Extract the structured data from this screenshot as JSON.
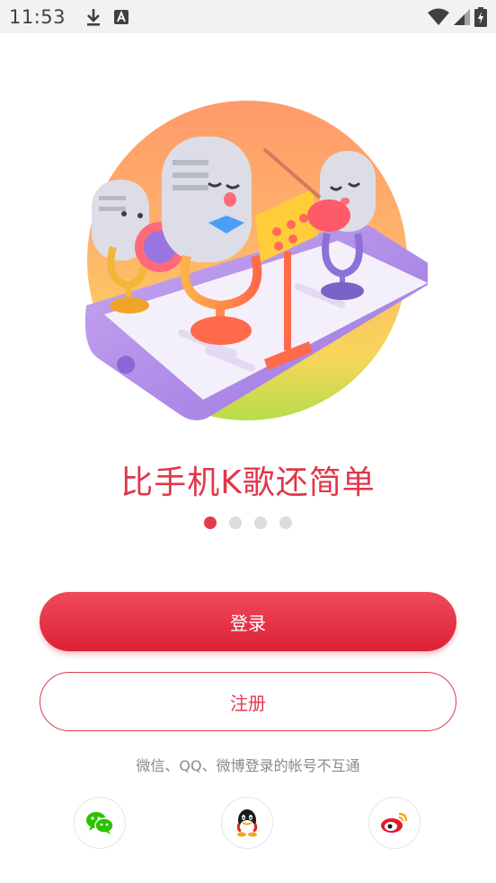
{
  "status_bar": {
    "time": "11:53",
    "left_icons": [
      "download-icon",
      "a-icon"
    ],
    "right_icons": [
      "wifi-icon",
      "signal-icon",
      "battery-icon"
    ]
  },
  "hero": {
    "illustration": "karaoke-microphones-illustration"
  },
  "tagline": "比手机K歌还简单",
  "pager": {
    "count": 4,
    "active": 0
  },
  "buttons": {
    "login": "登录",
    "register": "注册"
  },
  "notice": "微信、QQ、微博登录的帐号不互通",
  "social": [
    {
      "name": "wechat",
      "icon": "wechat-icon"
    },
    {
      "name": "qq",
      "icon": "qq-icon"
    },
    {
      "name": "weibo",
      "icon": "weibo-icon"
    }
  ],
  "colors": {
    "accent": "#e33a4e",
    "status_bar_bg": "#f2f2f2",
    "inactive_dot": "#dcdcdc"
  }
}
